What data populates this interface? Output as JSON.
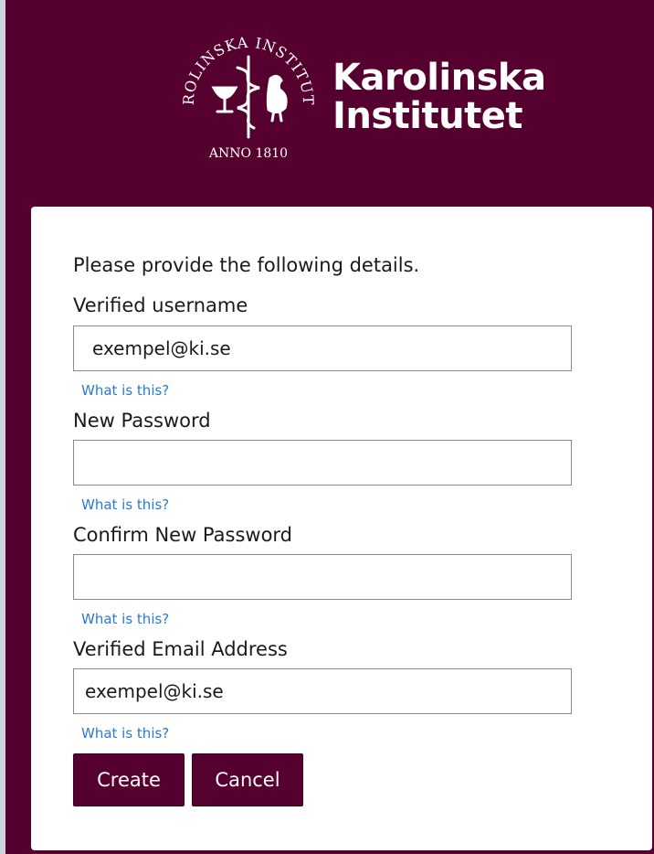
{
  "header": {
    "logo_line1": "Karolinska",
    "logo_line2": "Institutet",
    "seal_text_top": "KAROLINSKA INSTITUTET",
    "seal_text_bottom": "ANNO 1810"
  },
  "form": {
    "intro": "Please provide the following details.",
    "username": {
      "label": "Verified username",
      "value": "exempel@ki.se",
      "help": "What is this?"
    },
    "new_password": {
      "label": "New Password",
      "value": "",
      "help": "What is this?"
    },
    "confirm_password": {
      "label": "Confirm New Password",
      "value": "",
      "help": "What is this?"
    },
    "email": {
      "label": "Verified Email Address",
      "value": "exempel@ki.se",
      "help": "What is this?"
    },
    "create_label": "Create",
    "cancel_label": "Cancel"
  },
  "colors": {
    "brand": "#55002f",
    "link": "#2b79d1"
  }
}
